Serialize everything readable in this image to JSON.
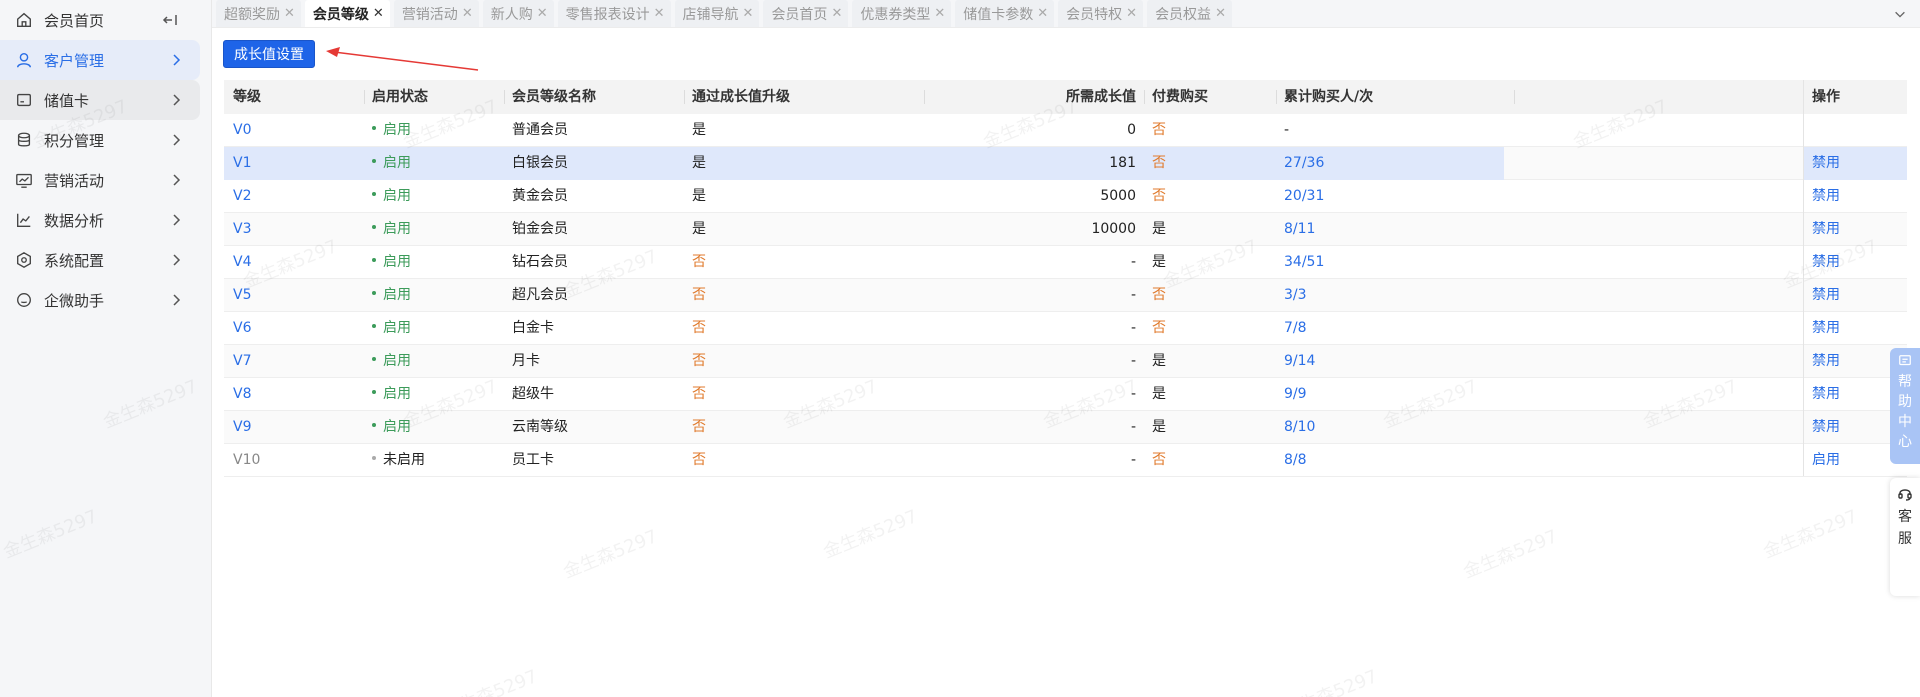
{
  "sidebar": {
    "items": [
      {
        "label": "会员首页",
        "icon": "home-icon"
      },
      {
        "label": "客户管理",
        "icon": "user-icon"
      },
      {
        "label": "储值卡",
        "icon": "card-icon"
      },
      {
        "label": "积分管理",
        "icon": "database-icon"
      },
      {
        "label": "营销活动",
        "icon": "chart-screen-icon"
      },
      {
        "label": "数据分析",
        "icon": "line-chart-icon"
      },
      {
        "label": "系统配置",
        "icon": "settings-icon"
      },
      {
        "label": "企微助手",
        "icon": "chat-icon"
      }
    ]
  },
  "tabs": [
    {
      "label": "超额奖励"
    },
    {
      "label": "会员等级"
    },
    {
      "label": "营销活动"
    },
    {
      "label": "新人购"
    },
    {
      "label": "零售报表设计"
    },
    {
      "label": "店铺导航"
    },
    {
      "label": "会员首页"
    },
    {
      "label": "优惠券类型"
    },
    {
      "label": "储值卡参数"
    },
    {
      "label": "会员特权"
    },
    {
      "label": "会员权益"
    }
  ],
  "toolbar": {
    "growth_setting": "成长值设置"
  },
  "table": {
    "headers": [
      "等级",
      "启用状态",
      "会员等级名称",
      "通过成长值升级",
      "所需成长值",
      "付费购买",
      "累计购买人/次",
      "操作"
    ],
    "rows": [
      {
        "level": "V0",
        "status": "启用",
        "name": "普通会员",
        "upgrade": "是",
        "growth": "0",
        "paid": "否",
        "count": "-",
        "op": ""
      },
      {
        "level": "V1",
        "status": "启用",
        "name": "白银会员",
        "upgrade": "是",
        "growth": "181",
        "paid": "否",
        "count": "27/36",
        "op": "禁用"
      },
      {
        "level": "V2",
        "status": "启用",
        "name": "黄金会员",
        "upgrade": "是",
        "growth": "5000",
        "paid": "否",
        "count": "20/31",
        "op": "禁用"
      },
      {
        "level": "V3",
        "status": "启用",
        "name": "铂金会员",
        "upgrade": "是",
        "growth": "10000",
        "paid": "是",
        "count": "8/11",
        "op": "禁用"
      },
      {
        "level": "V4",
        "status": "启用",
        "name": "钻石会员",
        "upgrade": "否",
        "growth": "-",
        "paid": "是",
        "count": "34/51",
        "op": "禁用"
      },
      {
        "level": "V5",
        "status": "启用",
        "name": "超凡会员",
        "upgrade": "否",
        "growth": "-",
        "paid": "否",
        "count": "3/3",
        "op": "禁用"
      },
      {
        "level": "V6",
        "status": "启用",
        "name": "白金卡",
        "upgrade": "否",
        "growth": "-",
        "paid": "否",
        "count": "7/8",
        "op": "禁用"
      },
      {
        "level": "V7",
        "status": "启用",
        "name": "月卡",
        "upgrade": "否",
        "growth": "-",
        "paid": "是",
        "count": "9/14",
        "op": "禁用"
      },
      {
        "level": "V8",
        "status": "启用",
        "name": "超级牛",
        "upgrade": "否",
        "growth": "-",
        "paid": "是",
        "count": "9/9",
        "op": "禁用"
      },
      {
        "level": "V9",
        "status": "启用",
        "name": "云南等级",
        "upgrade": "否",
        "growth": "-",
        "paid": "是",
        "count": "8/10",
        "op": "禁用"
      },
      {
        "level": "V10",
        "status": "未启用",
        "name": "员工卡",
        "upgrade": "否",
        "growth": "-",
        "paid": "否",
        "count": "8/8",
        "op": "启用"
      }
    ]
  },
  "float": {
    "help_chars": [
      "帮",
      "助",
      "中",
      "心"
    ],
    "service_chars": [
      "客",
      "服"
    ]
  },
  "watermark": "金生森5297",
  "colors": {
    "primary": "#1e64e8",
    "link": "#2a6ee6",
    "enabled": "#3c9b5a",
    "no": "#e07a2c",
    "annotation": "#e53935"
  }
}
